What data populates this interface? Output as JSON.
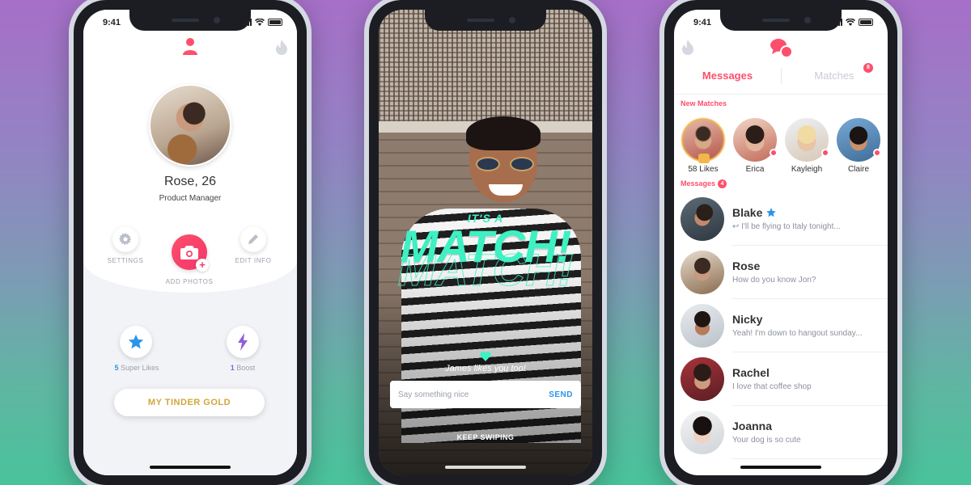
{
  "colors": {
    "brand": "#fd4f6b",
    "teal": "#3ff0c2",
    "blue": "#2b95e7",
    "gold": "#d2a63a",
    "purple": "#8e5fd8"
  },
  "profile_screen": {
    "status_time": "9:41",
    "name_age": "Rose, 26",
    "job": "Product Manager",
    "settings_label": "SETTINGS",
    "add_photos_label": "ADD PHOTOS",
    "edit_info_label": "EDIT INFO",
    "super_likes_count": "5",
    "super_likes_label": "Super Likes",
    "boost_count": "1",
    "boost_label": "Boost",
    "gold_button": "MY TINDER GOLD",
    "icons": [
      "profile-icon",
      "flame-icon",
      "gear-icon",
      "camera-icon",
      "pencil-icon",
      "star-icon",
      "bolt-icon"
    ]
  },
  "match_screen": {
    "its_a": "IT'S A",
    "match": "MATCH!",
    "likes_text": "James likes you too!",
    "message_placeholder": "Say something nice",
    "send_label": "SEND",
    "keep_swiping": "KEEP SWIPING"
  },
  "messages_screen": {
    "status_time": "9:41",
    "tab_messages": "Messages",
    "tab_matches": "Matches",
    "matches_badge": "8",
    "new_matches_heading": "New Matches",
    "messages_heading": "Messages",
    "messages_badge": "4",
    "new_matches": [
      {
        "label": "58 Likes"
      },
      {
        "label": "Erica"
      },
      {
        "label": "Kayleigh"
      },
      {
        "label": "Claire"
      }
    ],
    "conversations": [
      {
        "name": "Blake",
        "preview": "↩ I'll be flying to Italy tonight..."
      },
      {
        "name": "Rose",
        "preview": "How do you know Jon?"
      },
      {
        "name": "Nicky",
        "preview": "Yeah! I'm down to hangout sunday..."
      },
      {
        "name": "Rachel",
        "preview": "I love that coffee shop"
      },
      {
        "name": "Joanna",
        "preview": "Your dog is so cute"
      }
    ]
  }
}
